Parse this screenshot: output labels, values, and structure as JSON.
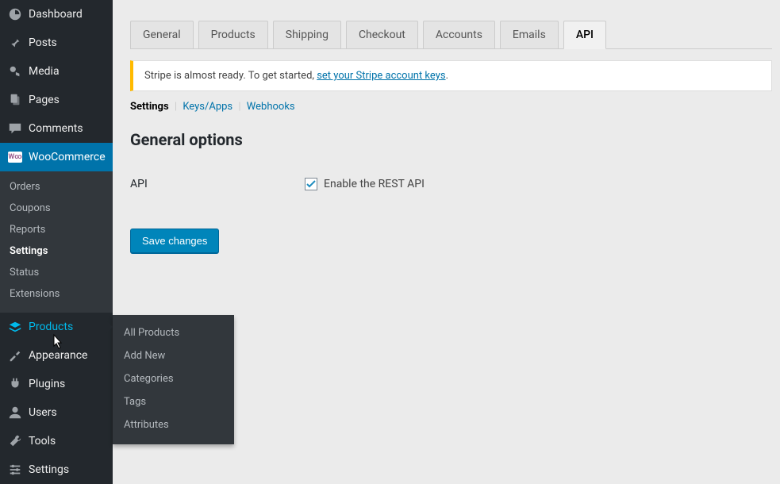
{
  "sidebar": {
    "items": [
      {
        "id": "dashboard",
        "label": "Dashboard",
        "icon": "dashboard-icon"
      },
      {
        "id": "posts",
        "label": "Posts",
        "icon": "pin-icon"
      },
      {
        "id": "media",
        "label": "Media",
        "icon": "media-icon"
      },
      {
        "id": "pages",
        "label": "Pages",
        "icon": "pages-icon"
      },
      {
        "id": "comments",
        "label": "Comments",
        "icon": "comments-icon"
      },
      {
        "id": "woocommerce",
        "label": "WooCommerce",
        "icon": "woo-icon",
        "current": true,
        "submenu": [
          {
            "label": "Orders"
          },
          {
            "label": "Coupons"
          },
          {
            "label": "Reports"
          },
          {
            "label": "Settings",
            "active": true
          },
          {
            "label": "Status"
          },
          {
            "label": "Extensions"
          }
        ]
      },
      {
        "id": "products",
        "label": "Products",
        "icon": "products-icon",
        "hover": true,
        "flyout": [
          {
            "label": "All Products"
          },
          {
            "label": "Add New"
          },
          {
            "label": "Categories"
          },
          {
            "label": "Tags"
          },
          {
            "label": "Attributes"
          }
        ]
      },
      {
        "id": "appearance",
        "label": "Appearance",
        "icon": "appearance-icon"
      },
      {
        "id": "plugins",
        "label": "Plugins",
        "icon": "plugins-icon"
      },
      {
        "id": "users",
        "label": "Users",
        "icon": "users-icon"
      },
      {
        "id": "tools",
        "label": "Tools",
        "icon": "tools-icon"
      },
      {
        "id": "settings",
        "label": "Settings",
        "icon": "settings-icon"
      }
    ]
  },
  "tabs": [
    {
      "label": "General"
    },
    {
      "label": "Products"
    },
    {
      "label": "Shipping"
    },
    {
      "label": "Checkout"
    },
    {
      "label": "Accounts"
    },
    {
      "label": "Emails"
    },
    {
      "label": "API",
      "active": true
    }
  ],
  "notice": {
    "prefix": "Stripe is almost ready. To get started, ",
    "link_text": "set your Stripe account keys",
    "suffix": "."
  },
  "subnav": {
    "current": "Settings",
    "links": [
      "Keys/Apps",
      "Webhooks"
    ]
  },
  "section": {
    "title": "General options",
    "api_label": "API",
    "checkbox_label": "Enable the REST API",
    "checkbox_checked": true
  },
  "buttons": {
    "save": "Save changes"
  },
  "colors": {
    "accent": "#0073aa",
    "button": "#0085ba",
    "warn_border": "#ffba00",
    "sidebar_bg": "#23282d",
    "hover": "#00b9eb"
  }
}
